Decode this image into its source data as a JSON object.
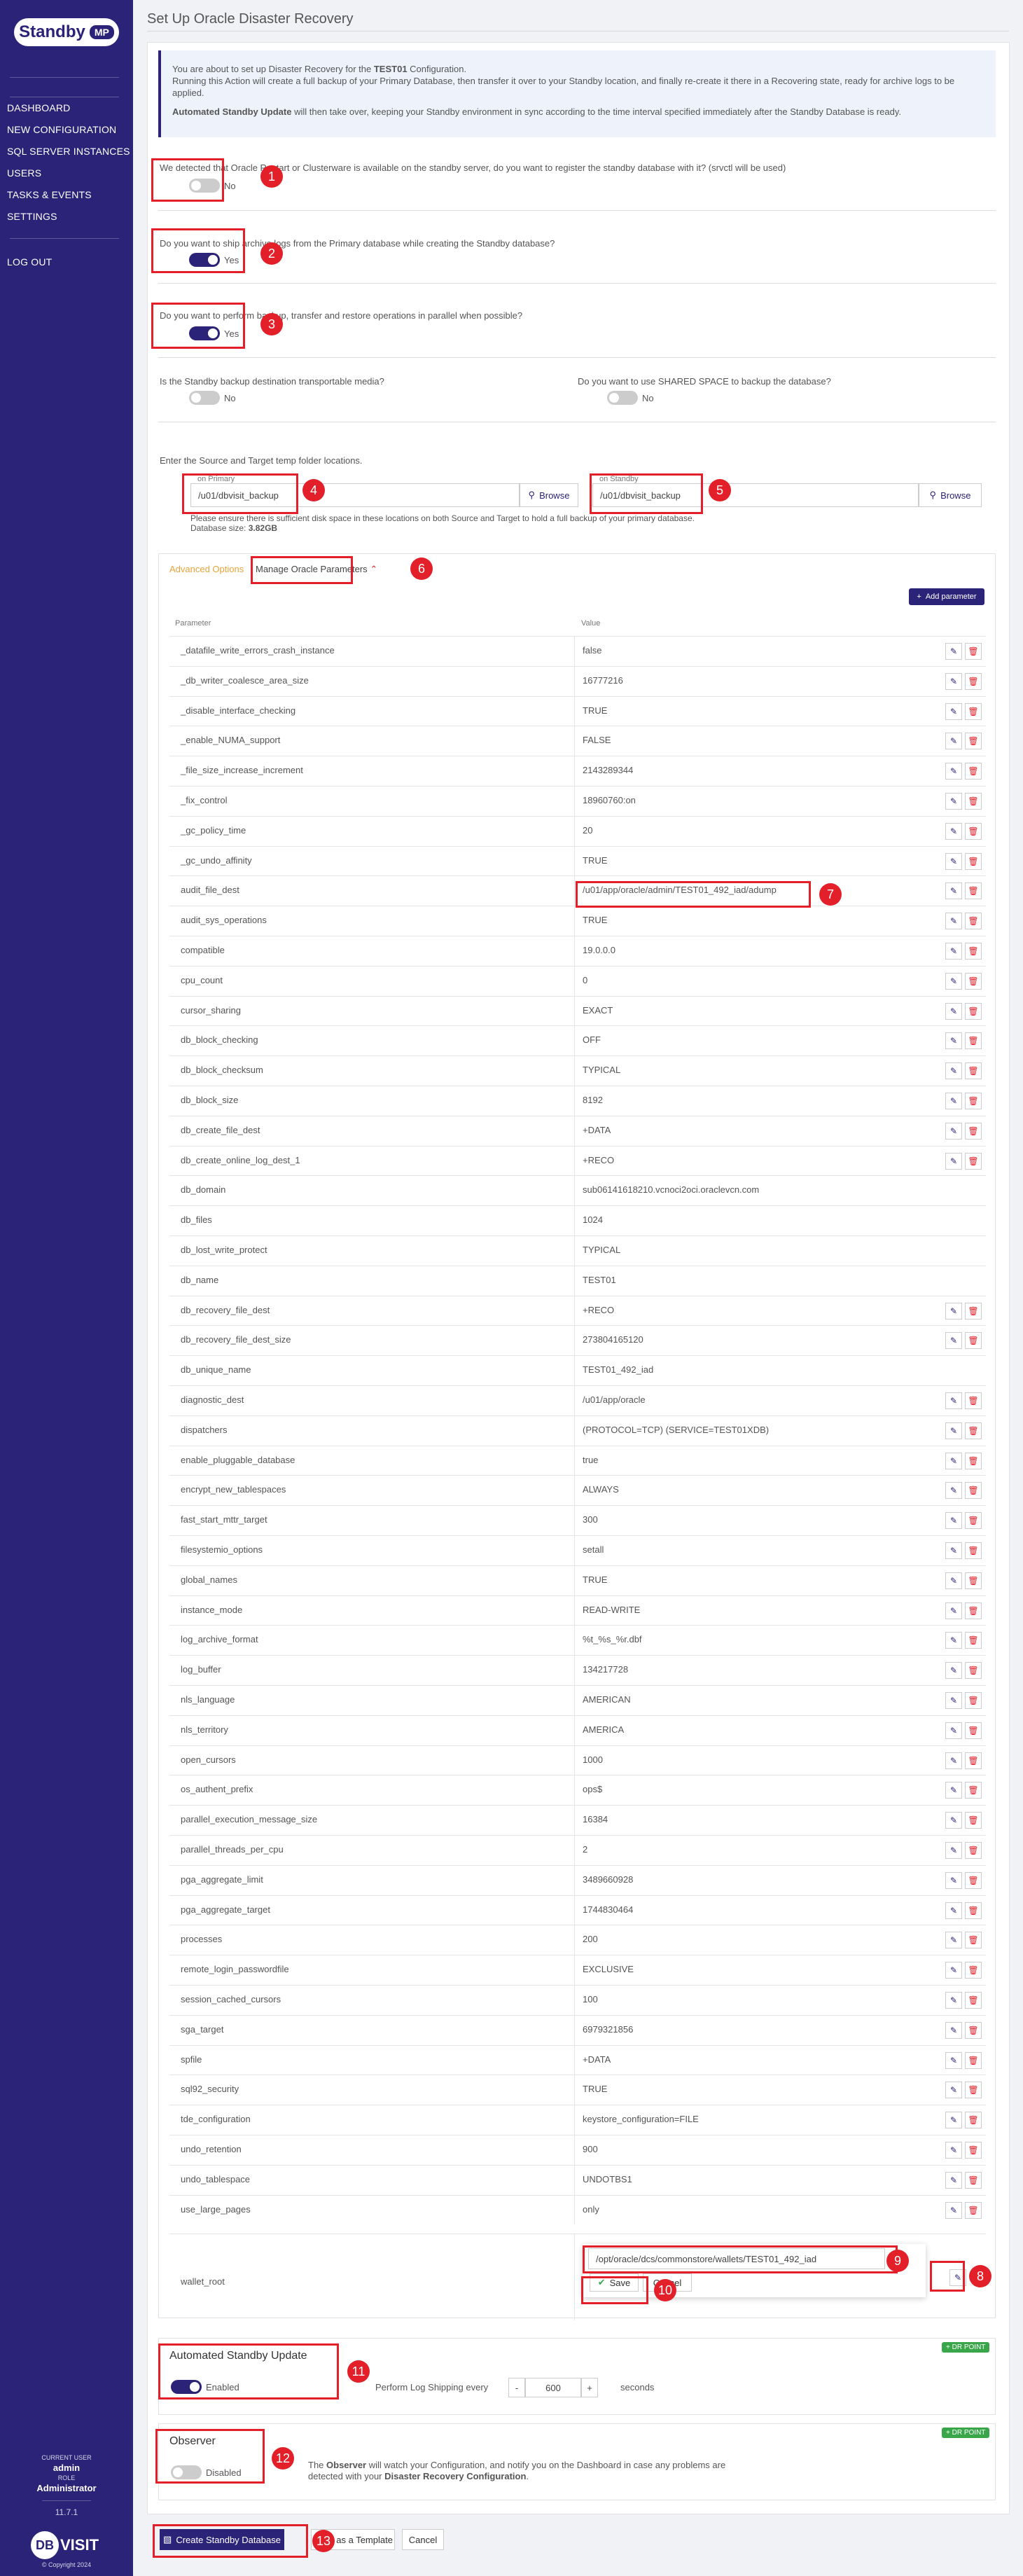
{
  "sidebar": {
    "logo_text": "Standby",
    "logo_badge": "MP",
    "nav": [
      "DASHBOARD",
      "NEW CONFIGURATION",
      "SQL SERVER INSTANCES",
      "USERS",
      "TASKS & EVENTS",
      "SETTINGS",
      "LOG OUT"
    ],
    "current_user_label": "CURRENT USER",
    "user": "admin",
    "role_label": "ROLE",
    "role": "Administrator",
    "version": "11.7.1",
    "brand": "DBVISIT",
    "brand_circle": "DB",
    "brand_rest": "VISIT",
    "copyright": "© Copyright 2024"
  },
  "page": {
    "title": "Set Up Oracle Disaster Recovery"
  },
  "info": {
    "line1_pre": "You are about to set up Disaster Recovery for the ",
    "line1_bold": "TEST01",
    "line1_post": " Configuration.",
    "line2": "Running this Action will create a full backup of your Primary Database, then transfer it over to your Standby location, and finally re-create it there in a Recovering state, ready for archive logs to be applied.",
    "line3_bold": "Automated Standby Update",
    "line3_post": " will then take over, keeping your Standby environment in sync according to the time interval specified immediately after the Standby Database is ready."
  },
  "questions": {
    "q1": "We detected that Oracle Restart or Clusterware is available on the standby server, do you want to register the standby database with it? (srvctl will be used)",
    "q1_val": "No",
    "q2": "Do you want to ship archive logs from the Primary database while creating the Standby database?",
    "q2_val": "Yes",
    "q3": "Do you want to perform backup, transfer and restore operations in parallel when possible?",
    "q3_val": "Yes",
    "q4": "Is the Standby backup destination transportable media?",
    "q4_val": "No",
    "q5": "Do you want to use SHARED SPACE to backup the database?",
    "q5_val": "No"
  },
  "temp": {
    "label": "Enter the Source and Target temp folder locations.",
    "primary_label": "on Primary",
    "primary_value": "/u01/dbvisit_backup",
    "standby_label": "on Standby",
    "standby_value": "/u01/dbvisit_backup",
    "browse": "Browse",
    "note": "Please ensure there is sufficient disk space in these locations on both Source and Target to hold a full backup of your primary database.",
    "db_size_label": "Database size: ",
    "db_size": "3.82GB"
  },
  "advanced": {
    "tab_advanced": "Advanced Options",
    "tab_manage": "Manage Oracle Parameters",
    "add_param": "Add parameter",
    "col_param": "Parameter",
    "col_value": "Value"
  },
  "params": [
    {
      "n": "_datafile_write_errors_crash_instance",
      "v": "false",
      "a": true
    },
    {
      "n": "_db_writer_coalesce_area_size",
      "v": "16777216",
      "a": true
    },
    {
      "n": "_disable_interface_checking",
      "v": "TRUE",
      "a": true
    },
    {
      "n": "_enable_NUMA_support",
      "v": "FALSE",
      "a": true
    },
    {
      "n": "_file_size_increase_increment",
      "v": "2143289344",
      "a": true
    },
    {
      "n": "_fix_control",
      "v": "18960760:on",
      "a": true
    },
    {
      "n": "_gc_policy_time",
      "v": "20",
      "a": true
    },
    {
      "n": "_gc_undo_affinity",
      "v": "TRUE",
      "a": true
    },
    {
      "n": "audit_file_dest",
      "v": "/u01/app/oracle/admin/TEST01_492_iad/adump",
      "a": true
    },
    {
      "n": "audit_sys_operations",
      "v": "TRUE",
      "a": true
    },
    {
      "n": "compatible",
      "v": "19.0.0.0",
      "a": true
    },
    {
      "n": "cpu_count",
      "v": "0",
      "a": true
    },
    {
      "n": "cursor_sharing",
      "v": "EXACT",
      "a": true
    },
    {
      "n": "db_block_checking",
      "v": "OFF",
      "a": true
    },
    {
      "n": "db_block_checksum",
      "v": "TYPICAL",
      "a": true
    },
    {
      "n": "db_block_size",
      "v": "8192",
      "a": true
    },
    {
      "n": "db_create_file_dest",
      "v": "+DATA",
      "a": true
    },
    {
      "n": "db_create_online_log_dest_1",
      "v": "+RECO",
      "a": true
    },
    {
      "n": "db_domain",
      "v": "sub06141618210.vcnoci2oci.oraclevcn.com",
      "a": false
    },
    {
      "n": "db_files",
      "v": "1024",
      "a": false
    },
    {
      "n": "db_lost_write_protect",
      "v": "TYPICAL",
      "a": false
    },
    {
      "n": "db_name",
      "v": "TEST01",
      "a": false
    },
    {
      "n": "db_recovery_file_dest",
      "v": "+RECO",
      "a": true
    },
    {
      "n": "db_recovery_file_dest_size",
      "v": "273804165120",
      "a": true
    },
    {
      "n": "db_unique_name",
      "v": "TEST01_492_iad",
      "a": false
    },
    {
      "n": "diagnostic_dest",
      "v": "/u01/app/oracle",
      "a": true
    },
    {
      "n": "dispatchers",
      "v": "(PROTOCOL=TCP) (SERVICE=TEST01XDB)",
      "a": true
    },
    {
      "n": "enable_pluggable_database",
      "v": "true",
      "a": true
    },
    {
      "n": "encrypt_new_tablespaces",
      "v": "ALWAYS",
      "a": true
    },
    {
      "n": "fast_start_mttr_target",
      "v": "300",
      "a": true
    },
    {
      "n": "filesystemio_options",
      "v": "setall",
      "a": true
    },
    {
      "n": "global_names",
      "v": "TRUE",
      "a": true
    },
    {
      "n": "instance_mode",
      "v": "READ-WRITE",
      "a": true
    },
    {
      "n": "log_archive_format",
      "v": "%t_%s_%r.dbf",
      "a": true
    },
    {
      "n": "log_buffer",
      "v": "134217728",
      "a": true
    },
    {
      "n": "nls_language",
      "v": "AMERICAN",
      "a": true
    },
    {
      "n": "nls_territory",
      "v": "AMERICA",
      "a": true
    },
    {
      "n": "open_cursors",
      "v": "1000",
      "a": true
    },
    {
      "n": "os_authent_prefix",
      "v": "ops$",
      "a": true
    },
    {
      "n": "parallel_execution_message_size",
      "v": "16384",
      "a": true
    },
    {
      "n": "parallel_threads_per_cpu",
      "v": "2",
      "a": true
    },
    {
      "n": "pga_aggregate_limit",
      "v": "3489660928",
      "a": true
    },
    {
      "n": "pga_aggregate_target",
      "v": "1744830464",
      "a": true
    },
    {
      "n": "processes",
      "v": "200",
      "a": true
    },
    {
      "n": "remote_login_passwordfile",
      "v": "EXCLUSIVE",
      "a": true
    },
    {
      "n": "session_cached_cursors",
      "v": "100",
      "a": true
    },
    {
      "n": "sga_target",
      "v": "6979321856",
      "a": true
    },
    {
      "n": "spfile",
      "v": "+DATA",
      "a": true
    },
    {
      "n": "sql92_security",
      "v": "TRUE",
      "a": true
    },
    {
      "n": "tde_configuration",
      "v": "keystore_configuration=FILE",
      "a": true
    },
    {
      "n": "undo_retention",
      "v": "900",
      "a": true
    },
    {
      "n": "undo_tablespace",
      "v": "UNDOTBS1",
      "a": true
    },
    {
      "n": "use_large_pages",
      "v": "only",
      "a": true
    }
  ],
  "wallet": {
    "name": "wallet_root",
    "value": "/opt/oracle/dcs/commonstore/wallets/TEST01_492_iad",
    "save": "Save",
    "cancel": "Cancel"
  },
  "asu": {
    "title": "Automated Standby Update",
    "status": "Enabled",
    "ship_label": "Perform Log Shipping every",
    "minus": "-",
    "interval": "600",
    "plus": "+",
    "unit": "seconds",
    "badge": "+ DR POINT"
  },
  "observer": {
    "title": "Observer",
    "status": "Disabled",
    "desc_pre": "The ",
    "desc_bold": "Observer",
    "desc_post": " will watch your Configuration, and notify you on the Dashboard in case any problems are detected with your ",
    "desc_bold2": "Disaster Recovery Configuration",
    "desc_end": ".",
    "badge": "+ DR POINT"
  },
  "footer": {
    "create": "Create Standby Database",
    "template": "Save as a Template",
    "cancel": "Cancel"
  },
  "markers": [
    "1",
    "2",
    "3",
    "4",
    "5",
    "6",
    "7",
    "8",
    "9",
    "10",
    "11",
    "12",
    "13"
  ]
}
